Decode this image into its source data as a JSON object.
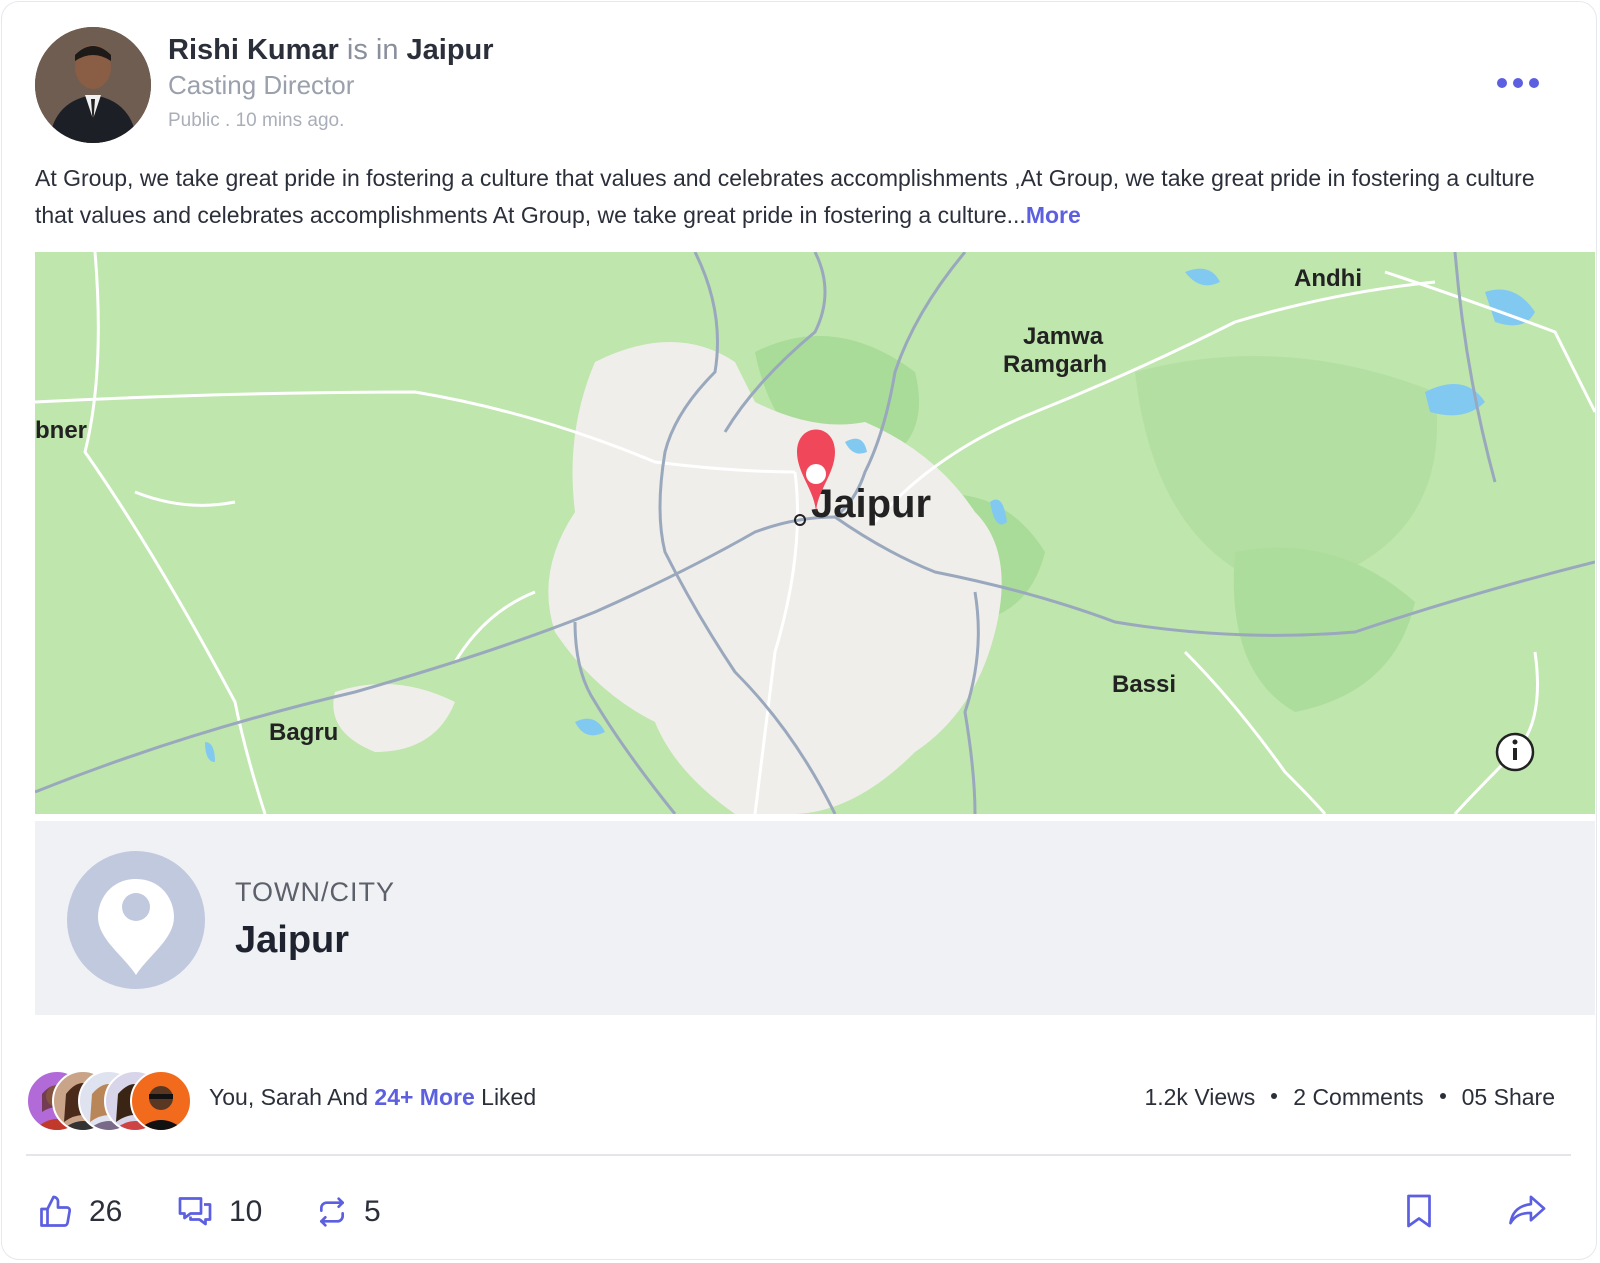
{
  "post": {
    "author": "Rishi Kumar",
    "connector": "is in",
    "location": "Jaipur",
    "role": "Casting Director",
    "meta": "Public . 10 mins ago.",
    "body": "At Group, we take great pride in fostering a culture that values and celebrates accomplishments ,At Group, we take great pride in fostering a culture that values and celebrates accomplishments  At Group, we take great pride in fostering a culture...",
    "more_label": "More"
  },
  "map": {
    "labels": {
      "jaipur": "Jaipur",
      "andhi": "Andhi",
      "jamwa": "Jamwa",
      "ramgarh": "Ramgarh",
      "bner": "bner",
      "bagru": "Bagru",
      "bassi": "Bassi"
    },
    "colors": {
      "land": "#bfe6ad",
      "urban": "#f0eeea",
      "road": "#ffffff",
      "highway": "#9aa8be",
      "water": "#82c9f2",
      "pin": "#f0475a"
    }
  },
  "location_card": {
    "type_label": "TOWN/CITY",
    "name": "Jaipur"
  },
  "engagement": {
    "liked_prefix": "You, Sarah And",
    "liked_highlight": "24+ More",
    "liked_suffix": "Liked",
    "views": "1.2k Views",
    "comments": "2 Comments",
    "shares": "05 Share"
  },
  "actions": {
    "likes": "26",
    "comments": "10",
    "reposts": "5"
  },
  "theme": {
    "accent": "#5b5fe0",
    "text": "#2b2f3a",
    "muted": "#9aa0ac"
  },
  "icons": [
    "more-horizontal-icon",
    "map-pin-icon",
    "info-icon",
    "thumbs-up-icon",
    "comment-icon",
    "repost-icon",
    "bookmark-icon",
    "share-icon"
  ]
}
